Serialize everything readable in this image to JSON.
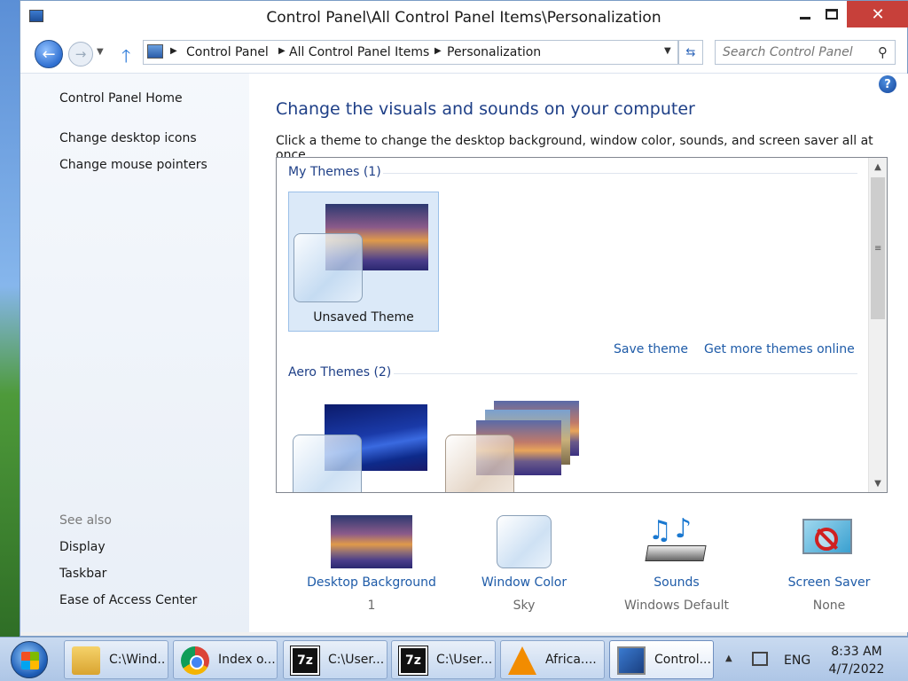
{
  "window": {
    "title": "Control Panel\\All Control Panel Items\\Personalization",
    "minimize_label": "",
    "maximize_label": "",
    "close_label": "✕"
  },
  "nav": {
    "back_icon": "←",
    "forward_icon": "→",
    "up_icon": "🡑",
    "breadcrumbs": [
      "Control Panel",
      "All Control Panel Items",
      "Personalization"
    ],
    "refresh_icon": "⇆",
    "search_placeholder": "Search Control Panel",
    "search_icon": "⚲"
  },
  "sidebar": {
    "home": "Control Panel Home",
    "links": [
      "Change desktop icons",
      "Change mouse pointers"
    ],
    "see_also_title": "See also",
    "see_also": [
      "Display",
      "Taskbar",
      "Ease of Access Center"
    ]
  },
  "main": {
    "help_label": "?",
    "heading": "Change the visuals and sounds on your computer",
    "subtext": "Click a theme to change the desktop background, window color, sounds, and screen saver all at once.",
    "groups": [
      {
        "label": "My Themes (1)",
        "themes": [
          {
            "name": "Unsaved Theme",
            "selected": true
          }
        ]
      },
      {
        "label": "Aero Themes (2)",
        "themes": [
          {
            "name": ""
          },
          {
            "name": ""
          }
        ]
      }
    ],
    "save_theme": "Save theme",
    "get_more": "Get more themes online"
  },
  "settings": [
    {
      "label": "Desktop Background",
      "value": "1",
      "icon": "landscape-thumbnail-icon"
    },
    {
      "label": "Window Color",
      "value": "Sky",
      "icon": "color-swatch-icon"
    },
    {
      "label": "Sounds",
      "value": "Windows Default",
      "icon": "music-notes-icon"
    },
    {
      "label": "Screen Saver",
      "value": "None",
      "icon": "screen-saver-none-icon"
    }
  ],
  "taskbar": {
    "tasks": [
      {
        "label": "C:\\Wind...",
        "icon": "folder-icon"
      },
      {
        "label": "Index o...",
        "icon": "chrome-icon"
      },
      {
        "label": "C:\\User...",
        "icon": "7zip-icon"
      },
      {
        "label": "C:\\User...",
        "icon": "7zip-icon"
      },
      {
        "label": "Africa....",
        "icon": "vlc-icon"
      },
      {
        "label": "Control...",
        "icon": "control-panel-icon"
      }
    ],
    "zip_text": "7z",
    "language": "ENG",
    "time": "8:33 AM",
    "date": "4/7/2022"
  },
  "colors": {
    "heading": "#1e3f87",
    "link": "#1e5ba8",
    "close_button": "#c7403a",
    "selection": "#dbe9f8"
  }
}
